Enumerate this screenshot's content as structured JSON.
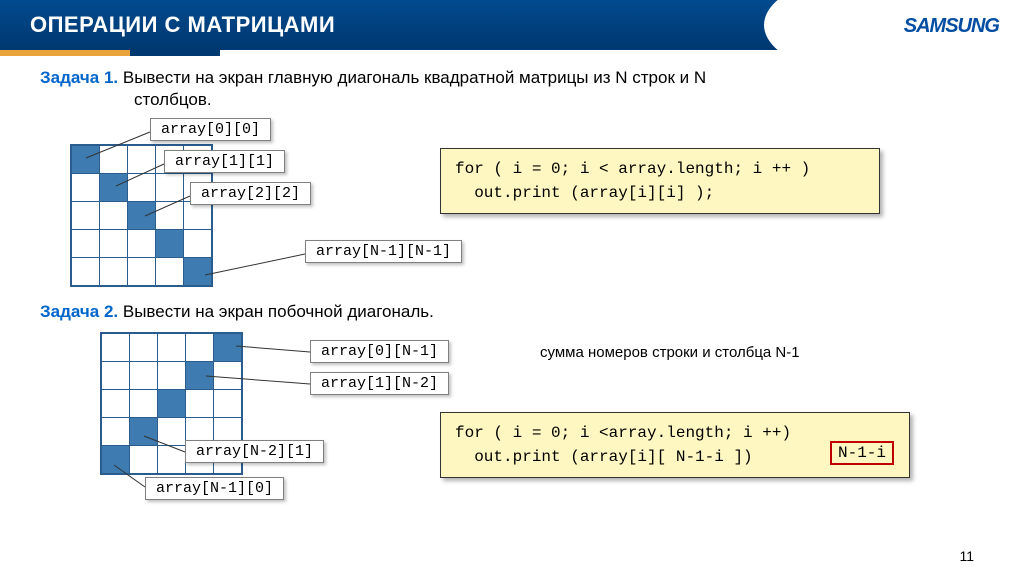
{
  "header": {
    "title": "ОПЕРАЦИИ С МАТРИЦАМИ",
    "logo": "SAMSUNG"
  },
  "task1": {
    "label": "Задача 1.",
    "text_a": " Вывести на экран главную диагональ квадратной матрицы из N строк и N",
    "text_b": "столбцов.",
    "labels": {
      "c00": "array[0][0]",
      "c11": "array[1][1]",
      "c22": "array[2][2]",
      "cnn": "array[N-1][N-1]"
    },
    "code": {
      "l1": "for ( i = 0;  i < array.length;  i ++ )",
      "l2": "  out.print (array[i][i] );"
    }
  },
  "task2": {
    "label": "Задача 2.",
    "text": " Вывести на экран побочной диагональ.",
    "note": "сумма номеров строки и столбца N-1",
    "labels": {
      "c0n1": "array[0][N-1]",
      "c1n2": "array[1][N-2]",
      "cn21": "array[N-2][1]",
      "cn10": "array[N-1][0]"
    },
    "code": {
      "l1": "for ( i = 0;  i <array.length;  i ++)",
      "l2": "  out.print (array[i][ N-1-i ])"
    },
    "highlight": "N-1-i"
  },
  "page": "11"
}
